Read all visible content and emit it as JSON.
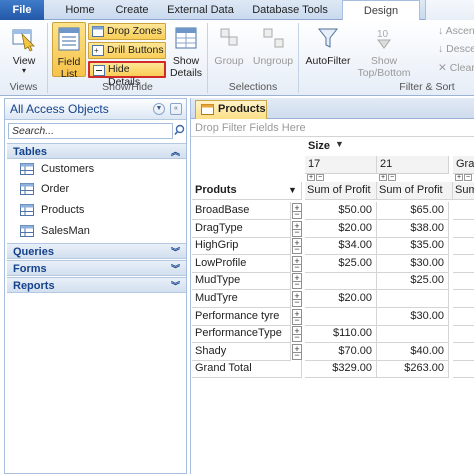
{
  "tabs": {
    "file": "File",
    "home": "Home",
    "create": "Create",
    "external": "External Data",
    "dbtools": "Database Tools",
    "design": "Design"
  },
  "ribbon": {
    "view_label": "View",
    "field_list_line1": "Field",
    "field_list_line2": "List",
    "drop_zones": "Drop Zones",
    "drill_buttons": "Drill Buttons",
    "hide_details": "Hide Details",
    "show_details_line1": "Show",
    "show_details_line2": "Details",
    "group": "Group",
    "ungroup": "Ungroup",
    "autofilter": "AutoFilter",
    "show_topbottom_line1": "Show",
    "show_topbottom_line2": "Top/Bottom",
    "show_topbottom_number": "10",
    "ascending": "Ascendi",
    "descending": "Descen",
    "clear_custom": "Clear Cu",
    "grp_views": "Views",
    "grp_showhide": "Show/Hide",
    "grp_selections": "Selections",
    "grp_filtersort": "Filter & Sort"
  },
  "nav": {
    "title": "All Access Objects",
    "search_placeholder": "Search...",
    "sections": {
      "tables": "Tables",
      "queries": "Queries",
      "forms": "Forms",
      "reports": "Reports"
    },
    "tables": [
      "Customers",
      "Order",
      "Products",
      "SalesMan"
    ]
  },
  "doc": {
    "tab_label": "Products",
    "drop_filter": "Drop Filter Fields Here",
    "column_field": "Size",
    "column_values": [
      "17",
      "21",
      "Gra"
    ],
    "row_field": "Produts",
    "measure": "Sum of Profit",
    "rows": [
      {
        "label": "BroadBase",
        "v17": "$50.00",
        "v21": "$65.00"
      },
      {
        "label": "DragType",
        "v17": "$20.00",
        "v21": "$38.00"
      },
      {
        "label": "HighGrip",
        "v17": "$34.00",
        "v21": "$35.00"
      },
      {
        "label": "LowProfile",
        "v17": "$25.00",
        "v21": "$30.00"
      },
      {
        "label": "MudType",
        "v17": "",
        "v21": "$25.00"
      },
      {
        "label": "MudTyre",
        "v17": "$20.00",
        "v21": ""
      },
      {
        "label": "Performance tyre",
        "v17": "",
        "v21": "$30.00"
      },
      {
        "label": "PerformanceType",
        "v17": "$110.00",
        "v21": ""
      },
      {
        "label": "Shady",
        "v17": "$70.00",
        "v21": "$40.00"
      }
    ],
    "grand_total_label": "Grand Total",
    "grand_total": {
      "v17": "$329.00",
      "v21": "$263.00"
    }
  }
}
